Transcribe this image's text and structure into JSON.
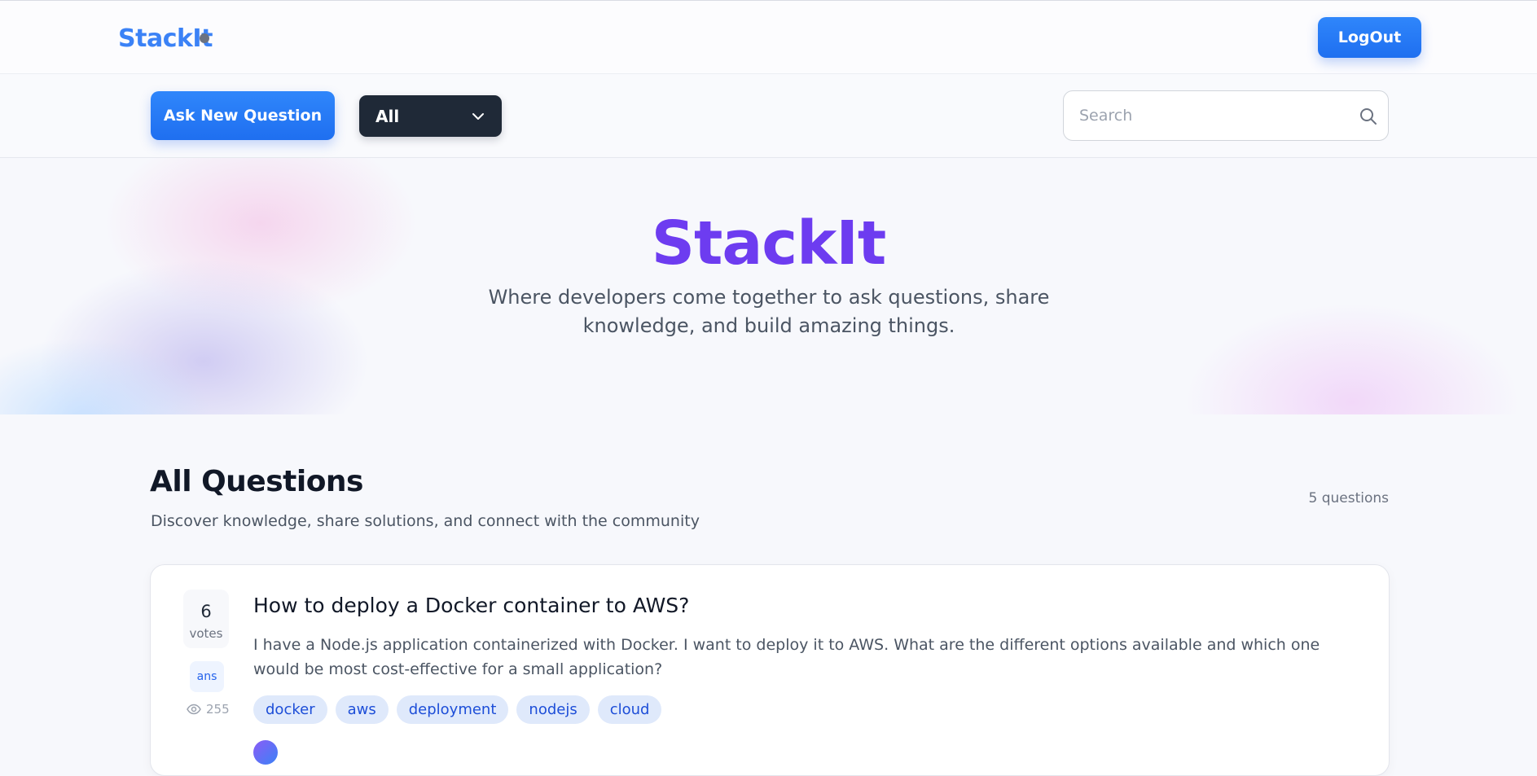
{
  "header": {
    "brand": "StackIt",
    "logout_label": "LogOut"
  },
  "toolbar": {
    "ask_label": "Ask New Question",
    "filter_value": "All",
    "search_placeholder": "Search"
  },
  "hero": {
    "title": "StackIt",
    "subtitle": "Where developers come together to ask questions, share knowledge, and build amazing things."
  },
  "questions_section": {
    "title": "All Questions",
    "subtitle": "Discover knowledge, share solutions, and connect with the community",
    "count_label": "5 questions"
  },
  "question": {
    "votes": "6",
    "votes_label": "votes",
    "answers_label": "ans",
    "views": "255",
    "title": "How to deploy a Docker container to AWS?",
    "excerpt": "I have a Node.js application containerized with Docker. I want to deploy it to AWS. What are the different options available and which one would be most cost-effective for a small application?",
    "tags": [
      "docker",
      "aws",
      "deployment",
      "nodejs",
      "cloud"
    ]
  },
  "colors": {
    "brand_blue": "#3b82f6",
    "hero_purple": "#6d3cf0",
    "button_blue": "#2f86fb",
    "filter_dark": "#1f2937",
    "tag_bg": "#dfe9fb"
  },
  "icons": {
    "search": "search-icon",
    "chevron": "chevron-down-icon",
    "views": "eye-icon"
  }
}
